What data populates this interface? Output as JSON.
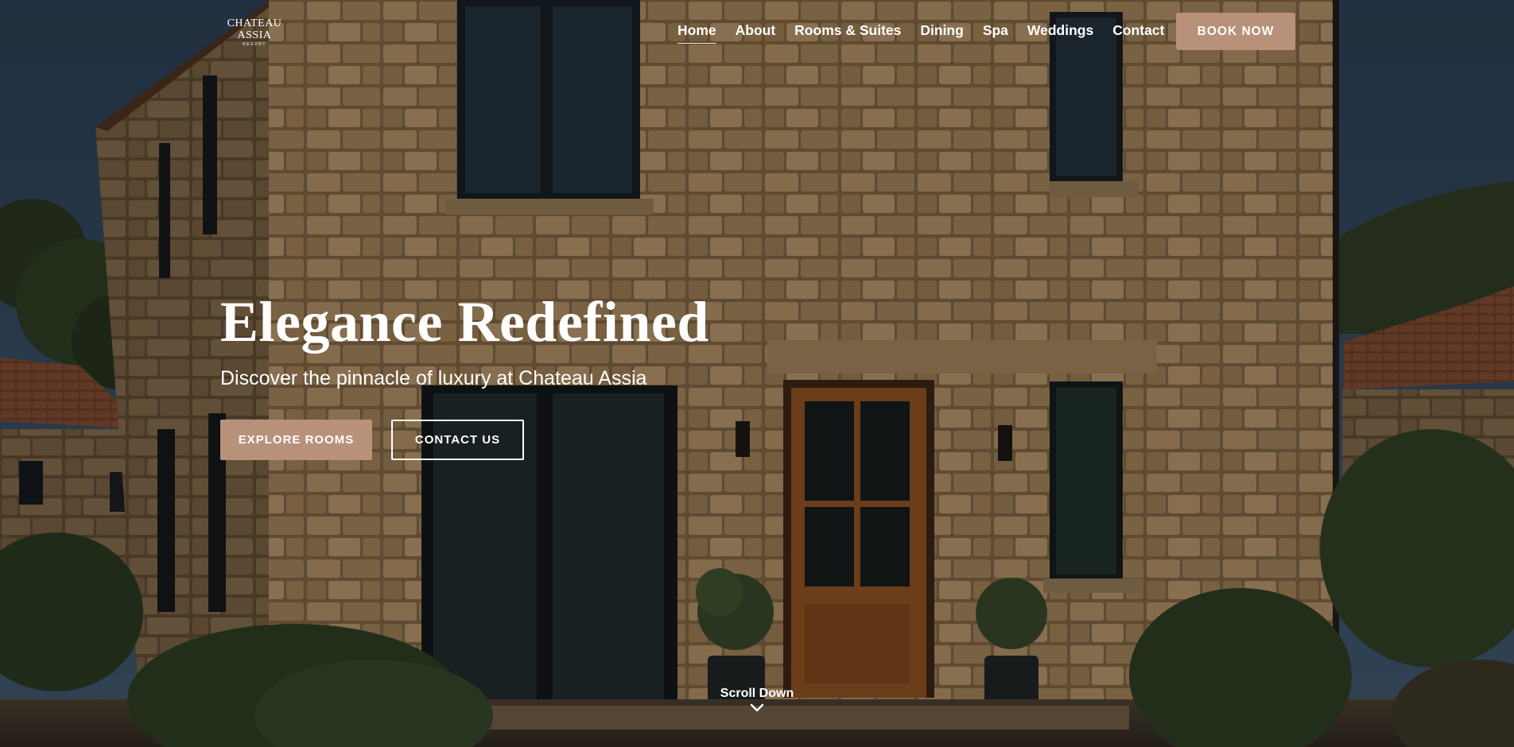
{
  "brand": {
    "line1": "CHATEAU",
    "line2": "ASSIA",
    "line3": "RESORT"
  },
  "nav": {
    "items": [
      {
        "label": "Home",
        "active": true
      },
      {
        "label": "About"
      },
      {
        "label": "Rooms & Suites"
      },
      {
        "label": "Dining"
      },
      {
        "label": "Spa"
      },
      {
        "label": "Weddings"
      },
      {
        "label": "Contact"
      }
    ],
    "book_label": "BOOK NOW"
  },
  "hero": {
    "title": "Elegance Redefined",
    "subtitle": "Discover the pinnacle of luxury at Chateau Assia",
    "primary_cta": "EXPLORE ROOMS",
    "secondary_cta": "CONTACT US",
    "scroll_label": "Scroll Down",
    "scroll_icon": "chevron-down-icon"
  },
  "colors": {
    "accent": "#b8917a",
    "text": "#ffffff",
    "sky": "#33475c"
  }
}
